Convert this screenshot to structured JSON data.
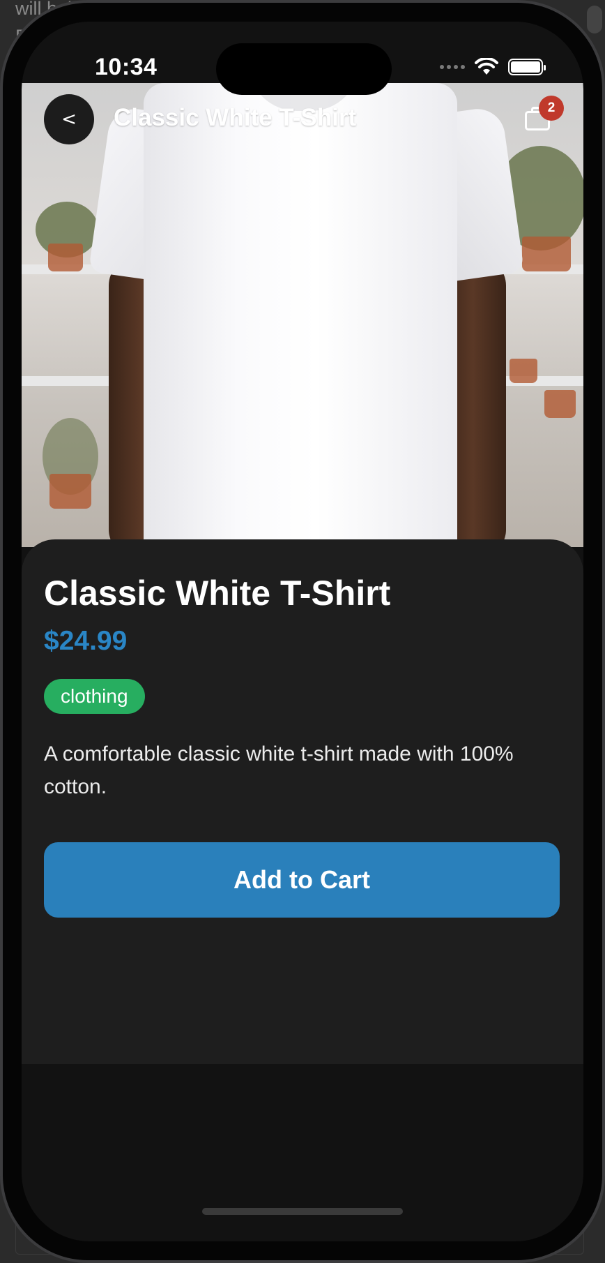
{
  "backdrop": {
    "text": "will hel\nEx"
  },
  "status_bar": {
    "time": "10:34"
  },
  "header": {
    "back_label": "<",
    "title": "Classic White T-Shirt",
    "cart_count": "2"
  },
  "product": {
    "name": "Classic White T-Shirt",
    "price": "$24.99",
    "category": "clothing",
    "description": "A comfortable classic white t-shirt made with 100% cotton."
  },
  "actions": {
    "add_to_cart_label": "Add to Cart"
  },
  "colors": {
    "accent": "#2a80bb",
    "price": "#2a86c6",
    "category_badge": "#27ae60",
    "cart_badge": "#c0392b",
    "sheet_background": "#1e1e1e",
    "screen_background": "#121212"
  },
  "icons": {
    "back": "chevron-left-icon",
    "cart": "cart-icon",
    "wifi": "wifi-icon",
    "battery": "battery-icon",
    "signal": "signal-dots-icon"
  }
}
